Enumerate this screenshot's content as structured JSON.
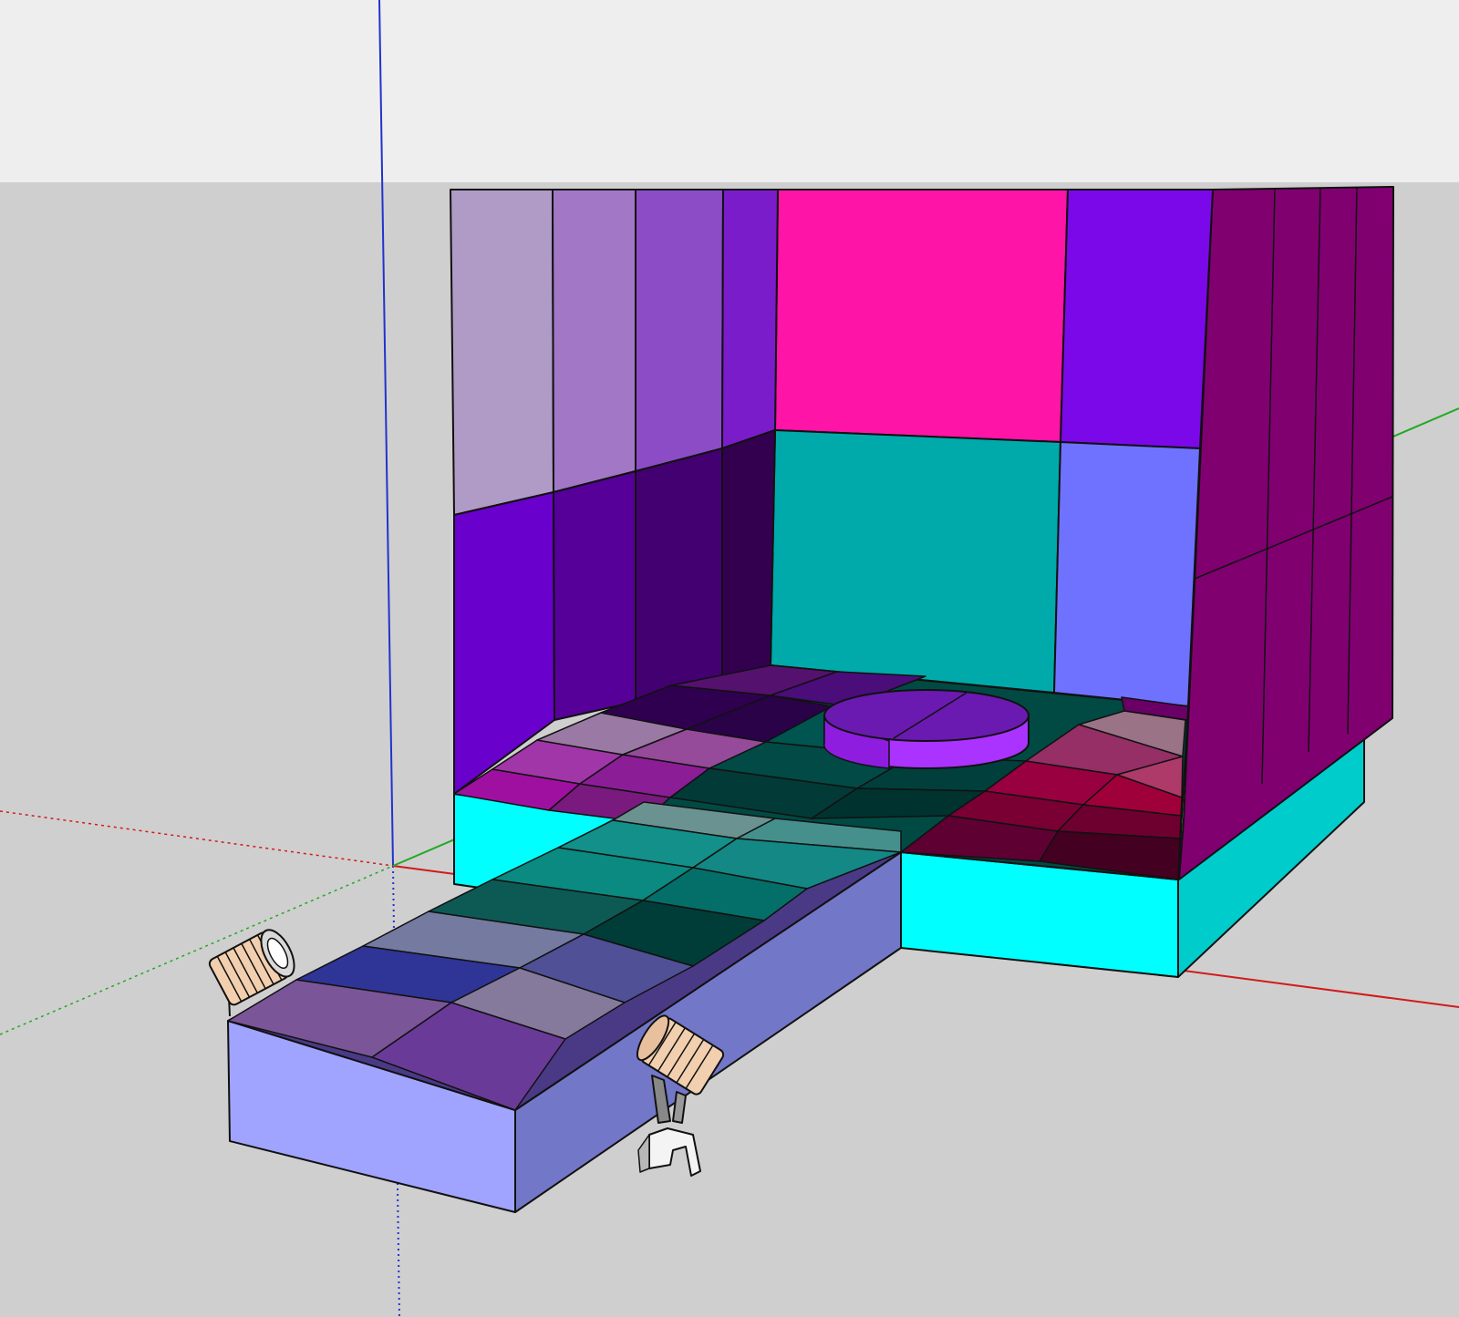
{
  "viewport": {
    "sky_color": "#eeeeee",
    "ground_color": "#cfcfcf",
    "axes": {
      "red_color": "#d21a1a",
      "green_color": "#22aa22",
      "blue_color": "#2233cc"
    }
  },
  "scene": {
    "model": "stage",
    "back_wall_colors": {
      "upper_center": "#ff14a8",
      "upper_right": "#7b08e8",
      "lower_center": "#00aaaa",
      "lower_right": "#6f72ff"
    },
    "left_wall_colors": {
      "upper": [
        "#b09ac6",
        "#a277c6",
        "#8c4cc6",
        "#7b1cca"
      ],
      "lower": [
        "#6a00cc",
        "#560099",
        "#430070",
        "#330050"
      ]
    },
    "right_wall_color": "#800070",
    "floor_base_color": "#00ffff",
    "floor_base_side_color": "#00cccc",
    "runway_side_colors": {
      "front": "#a0a4ff",
      "right": "#7377c8"
    },
    "pedestal_color": "#aa33ff",
    "spotlights": [
      "spotlight-left",
      "spotlight-right"
    ]
  }
}
